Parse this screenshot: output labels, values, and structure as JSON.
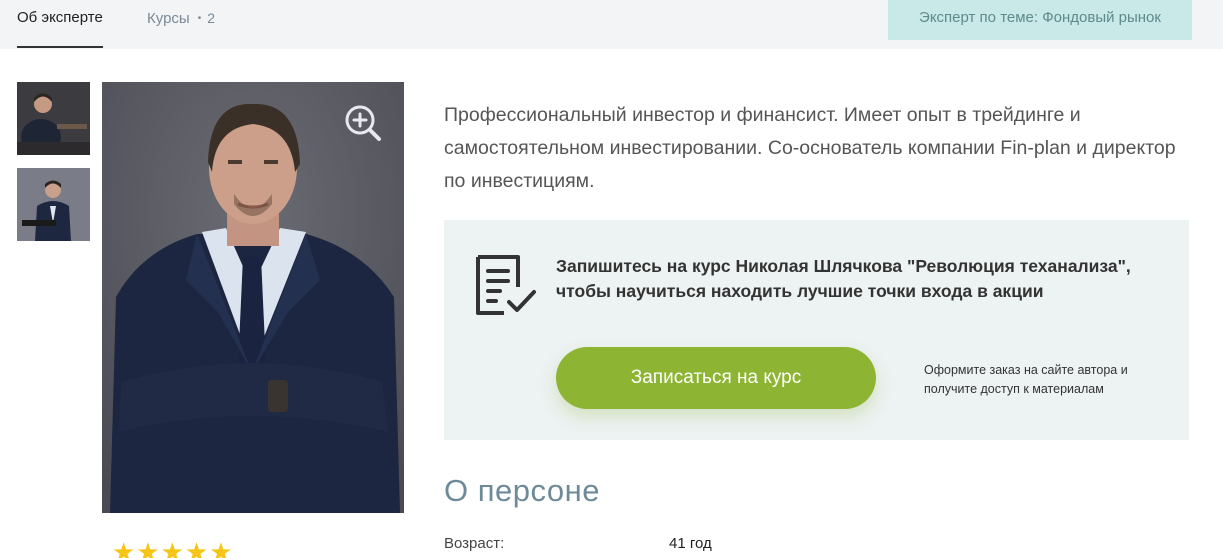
{
  "tabs": {
    "about_label": "Об эксперте",
    "courses_label": "Курсы",
    "courses_separator": "•",
    "courses_count": "2"
  },
  "expert_tag": "Эксперт по теме: Фондовый рынок",
  "gallery": {
    "thumbnails": [
      "expert-photo-1",
      "expert-photo-2"
    ],
    "zoom_icon": "zoom-in-icon"
  },
  "rating": {
    "stars_text": "★★★★★",
    "value": 5,
    "max": 5
  },
  "bio": "Профессиональный инвестор и финансист. Имеет опыт в трейдинге и самостоятельном инвестировании. Со-основатель компании Fin-plan и директор по инвестициям.",
  "cta": {
    "icon": "document-check-icon",
    "title": "Запишитесь на курс Николая Шлячкова \"Революция теханализа\", чтобы научиться находить лучшие точки входа в акции",
    "button_label": "Записаться на курс",
    "note": "Оформите заказ на сайте автора и получите доступ к материалам"
  },
  "about": {
    "title": "О персоне",
    "rows": [
      {
        "label": "Возраст:",
        "value": "41 год"
      }
    ]
  },
  "colors": {
    "accent_green": "#8db432",
    "tag_bg": "#c9e8e8",
    "topbar_bg": "#f2f4f5",
    "cta_bg": "#edf2f2",
    "star": "#f5c518"
  }
}
